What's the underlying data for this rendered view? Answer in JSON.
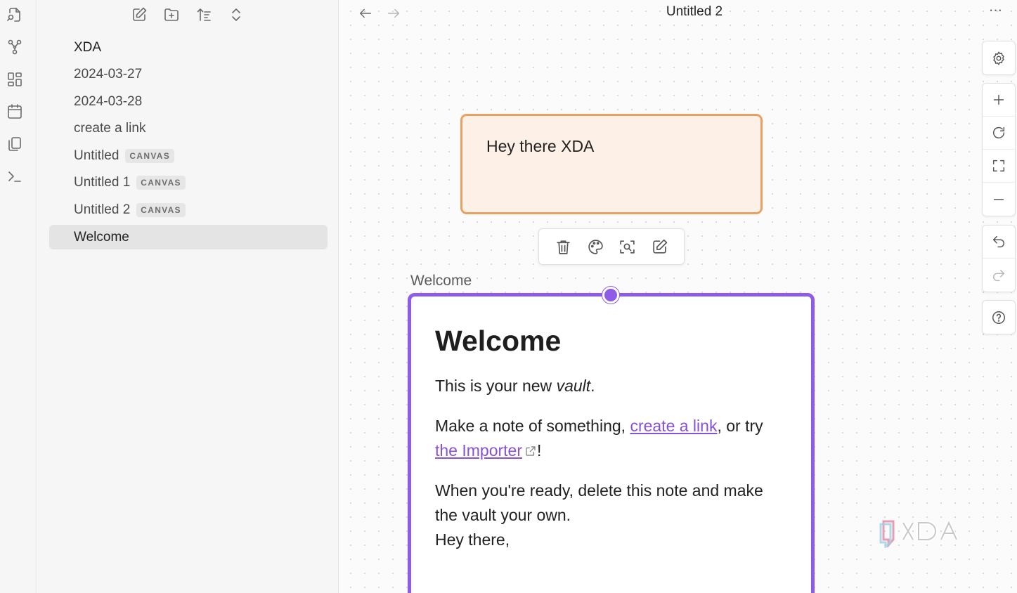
{
  "ribbon": {
    "icons": [
      "files-search-icon",
      "graph-icon",
      "canvas-grid-icon",
      "calendar-icon",
      "copy-pages-icon",
      "terminal-icon"
    ]
  },
  "sidebar": {
    "toolbar_icons": [
      "new-note-icon",
      "new-folder-icon",
      "sort-icon",
      "collapse-icon"
    ],
    "vault_name": "XDA",
    "items": [
      {
        "label": "2024-03-27",
        "tag": ""
      },
      {
        "label": "2024-03-28",
        "tag": ""
      },
      {
        "label": "create a link",
        "tag": ""
      },
      {
        "label": "Untitled",
        "tag": "CANVAS"
      },
      {
        "label": "Untitled 1",
        "tag": "CANVAS"
      },
      {
        "label": "Untitled 2",
        "tag": "CANVAS"
      },
      {
        "label": "Welcome",
        "tag": "",
        "active": true
      }
    ]
  },
  "header": {
    "title": "Untitled 2",
    "more": "···"
  },
  "canvas": {
    "card1": {
      "text": "Hey there XDA",
      "border_color": "#e9a060",
      "background": "#fdf1e7"
    },
    "card_toolbar_icons": [
      "trash-icon",
      "palette-icon",
      "zoom-to-card-icon",
      "edit-icon"
    ],
    "card2": {
      "label": "Welcome",
      "border_color": "#8e5ce6",
      "heading": "Welcome",
      "p1_before": "This is your new ",
      "p1_italic": "vault",
      "p1_after": ".",
      "p2_before": "Make a note of something, ",
      "p2_link1": "create a link",
      "p2_middle": ", or try",
      "p2_link2": "the Importer",
      "p2_after": "!",
      "p3_line1": "When you're ready, delete this note and make the vault your own.",
      "p3_line2": "Hey there,"
    },
    "controls": [
      "settings-icon",
      "zoom-in-icon",
      "reset-zoom-icon",
      "fit-screen-icon",
      "zoom-out-icon",
      "undo-icon",
      "redo-icon",
      "help-icon"
    ]
  },
  "watermark": "XDA"
}
